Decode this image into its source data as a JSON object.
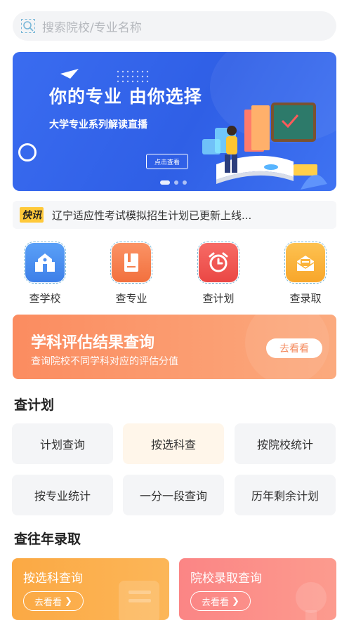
{
  "search": {
    "placeholder": "搜索院校/专业名称",
    "icon": "search-icon"
  },
  "banner": {
    "title": "你的专业 由你选择",
    "subtitle": "大学专业系列解读直播",
    "button": "点击查看",
    "colors": {
      "background": "#3166ec"
    }
  },
  "news": {
    "badge": "快讯",
    "text": "辽宁适应性考试模拟招生计划已更新上线..."
  },
  "quick_actions": [
    {
      "label": "查学校",
      "icon": "school-icon",
      "color": "#4d8ff0"
    },
    {
      "label": "查专业",
      "icon": "book-icon",
      "color": "#f6814f"
    },
    {
      "label": "查计划",
      "icon": "alarm-clock-icon",
      "color": "#f15a55"
    },
    {
      "label": "查录取",
      "icon": "envelope-icon",
      "color": "#fbb33a"
    }
  ],
  "evaluation": {
    "title": "学科评估结果查询",
    "subtitle": "查询院校不同学科对应的评估分值",
    "button": "去看看"
  },
  "plan_section": {
    "title": "查计划",
    "items": [
      "计划查询",
      "按选科查",
      "按院校统计",
      "按专业统计",
      "一分一段查询",
      "历年剩余计划"
    ]
  },
  "admission_section": {
    "title": "查往年录取",
    "cards": [
      {
        "title": "按选科查询",
        "button": "去看看",
        "color": "#fba944"
      },
      {
        "title": "院校录取查询",
        "button": "去看看",
        "color": "#fb8585"
      }
    ]
  }
}
